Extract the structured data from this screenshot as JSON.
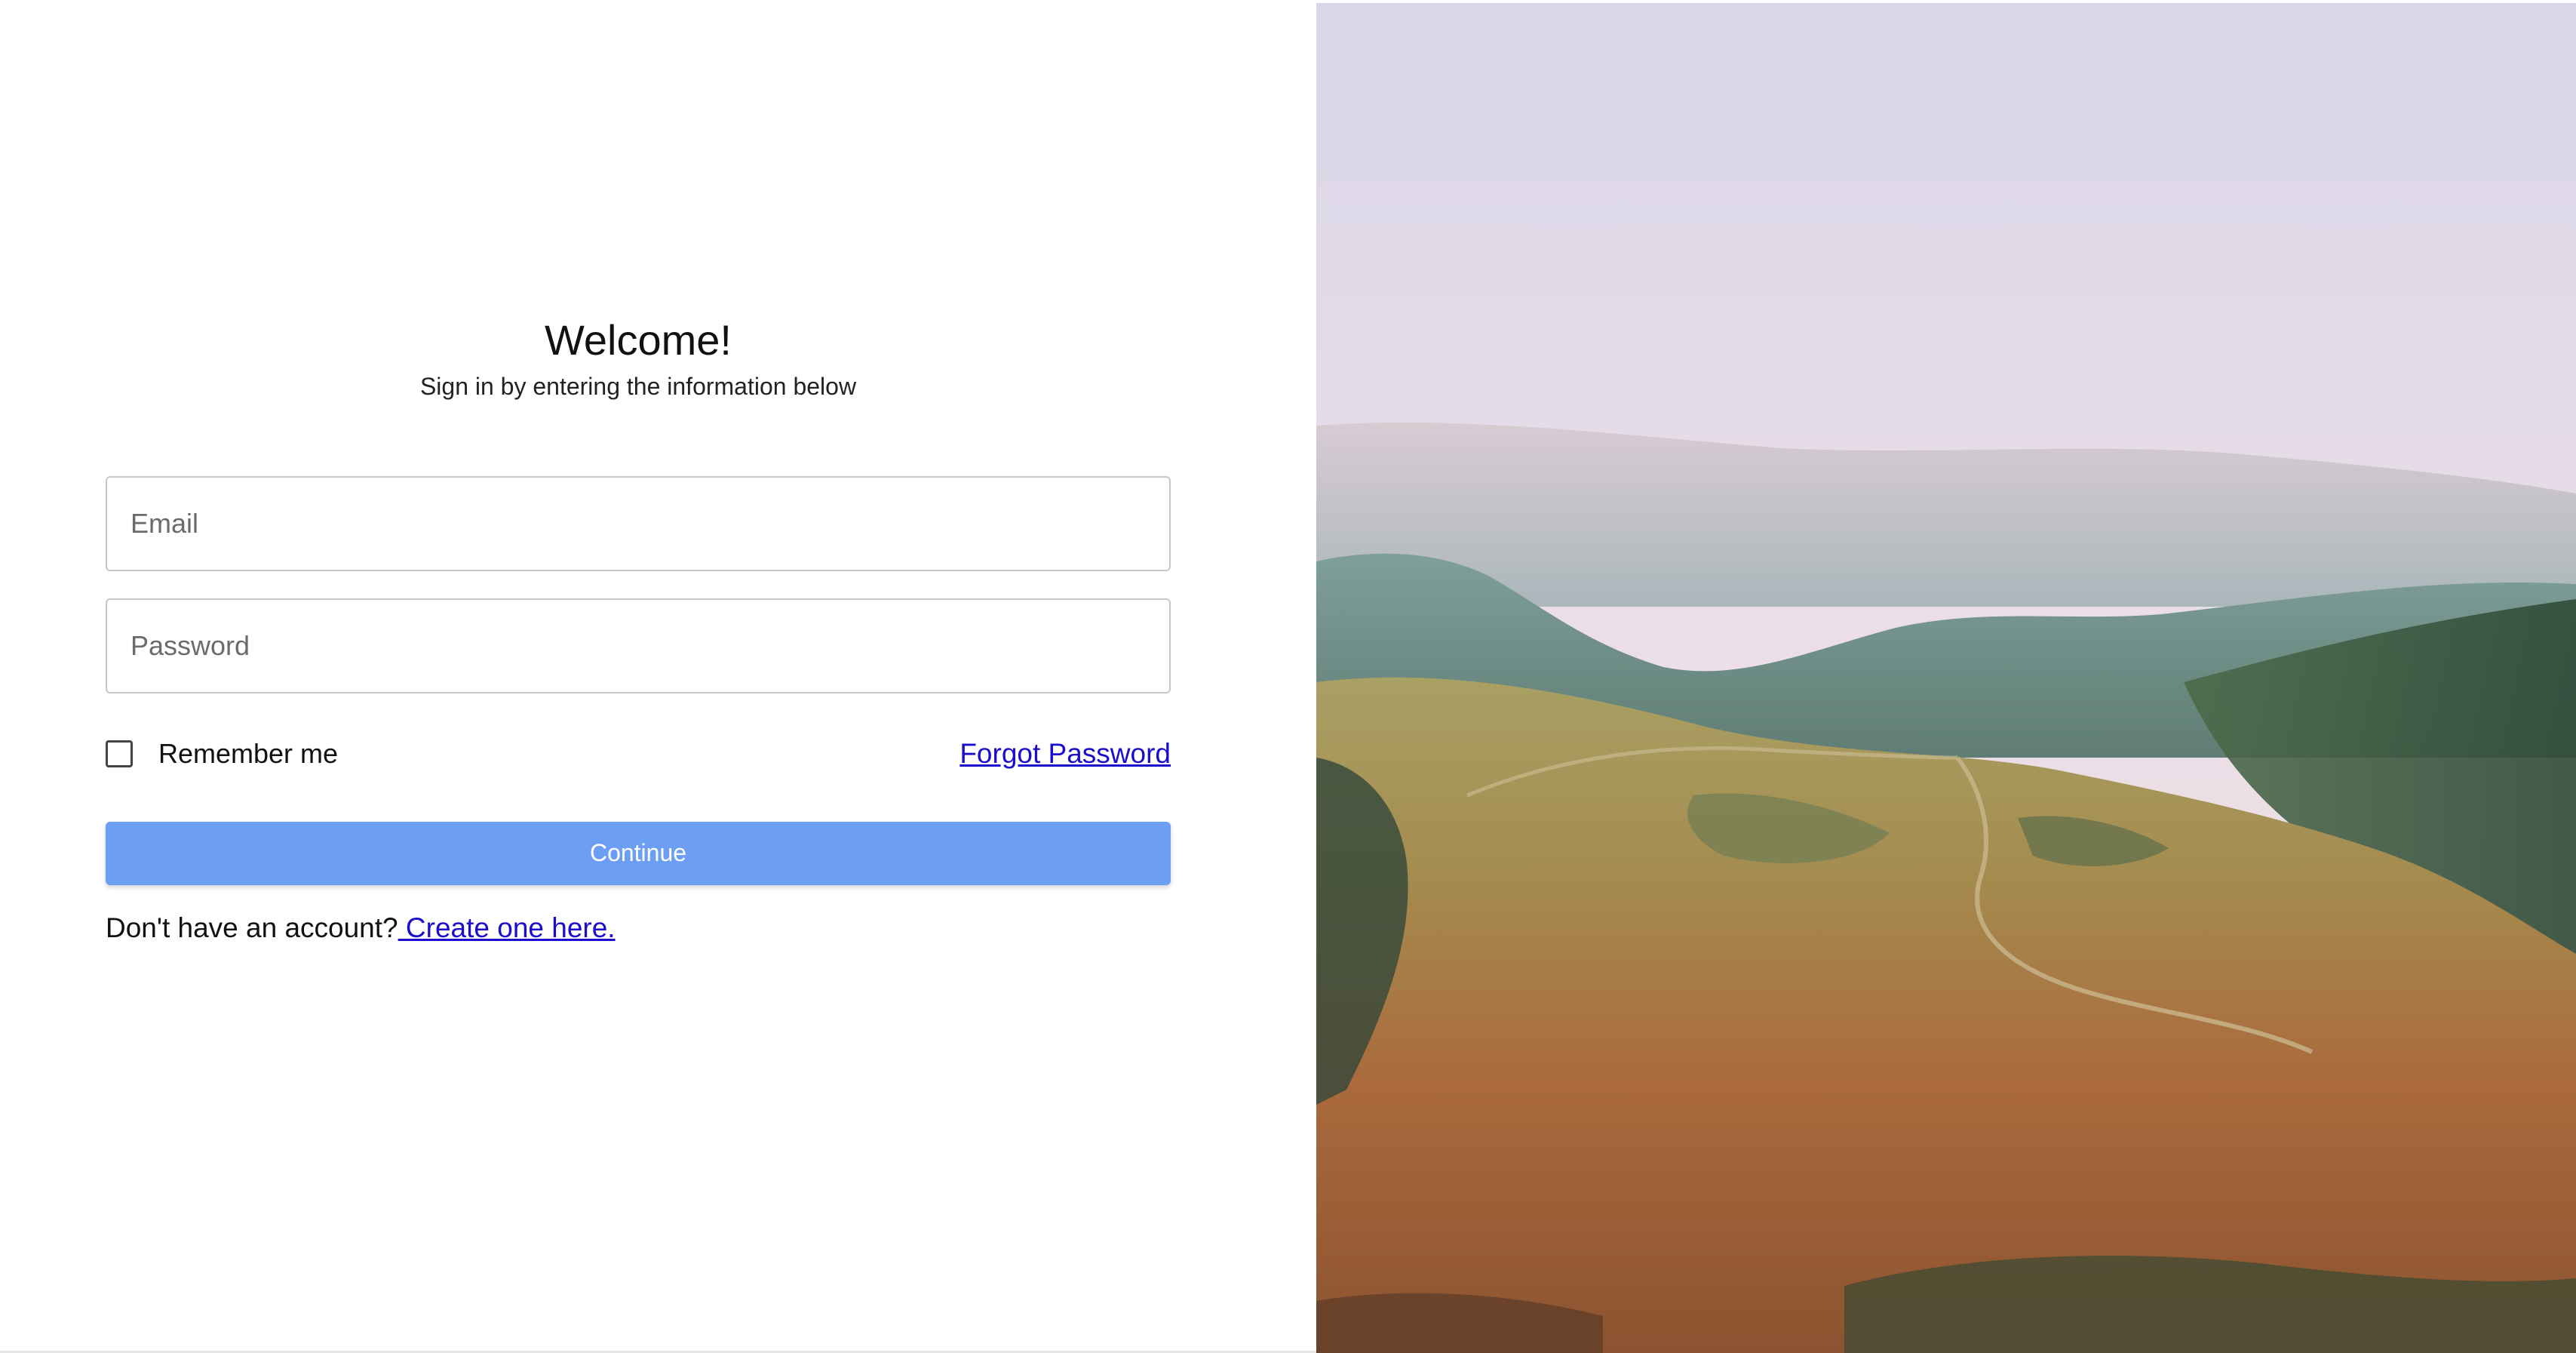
{
  "form": {
    "title": "Welcome!",
    "subtitle": "Sign in by entering the information below",
    "email": {
      "placeholder": "Email",
      "value": ""
    },
    "password": {
      "placeholder": "Password",
      "value": ""
    },
    "remember_me": {
      "label": "Remember me",
      "checked": false
    },
    "forgot_password": "Forgot Password",
    "continue_button": "Continue",
    "signup_prompt": "Don't have an account?",
    "signup_link": " Create one here."
  },
  "colors": {
    "button": "#6c9ff3",
    "link": "#1a0dcc",
    "input_border": "#c7c7c7"
  },
  "icons": {
    "remember_checkbox": "checkbox-unchecked-icon"
  }
}
